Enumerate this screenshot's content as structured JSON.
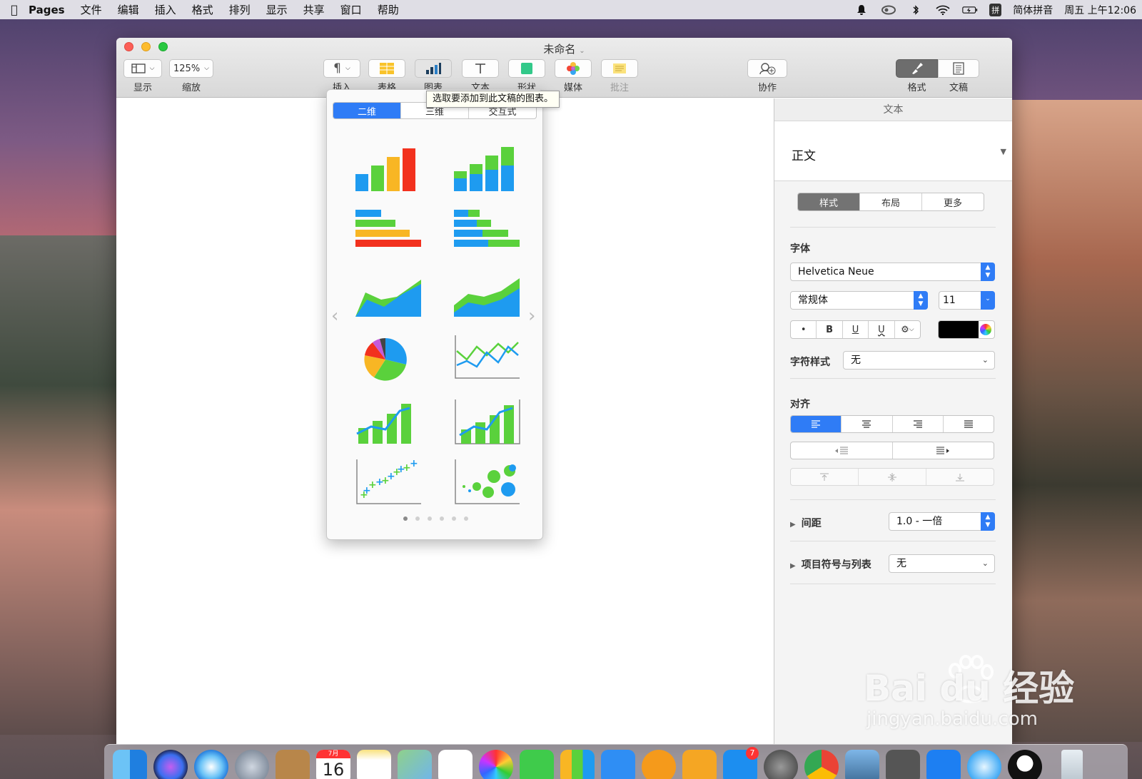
{
  "menubar": {
    "app_name": "Pages",
    "items": [
      "文件",
      "编辑",
      "插入",
      "格式",
      "排列",
      "显示",
      "共享",
      "窗口",
      "帮助"
    ],
    "input_method": "简体拼音",
    "input_badge": "拼",
    "clock": "周五 上午12:06"
  },
  "window": {
    "title": "未命名",
    "toolbar": {
      "view_label": "显示",
      "zoom_value": "125%",
      "zoom_label": "缩放",
      "insert_label": "插入",
      "table_label": "表格",
      "chart_label": "图表",
      "text_label": "文本",
      "shape_label": "形状",
      "media_label": "媒体",
      "comment_label": "批注",
      "collab_label": "协作",
      "format_label": "格式",
      "document_label": "文稿"
    }
  },
  "chart_popover": {
    "tabs": [
      "二维",
      "三维",
      "交互式"
    ],
    "active_tab": "二维",
    "tooltip": "选取要添加到此文稿的图表。",
    "page_count": 6,
    "current_page": 1,
    "chart_types": [
      "column",
      "stacked-column",
      "bar",
      "stacked-bar",
      "area",
      "stacked-area",
      "pie",
      "line",
      "mixed",
      "two-axis",
      "scatter",
      "bubble"
    ],
    "colors": {
      "blue": "#1e9bf0",
      "green": "#5ad13c",
      "orange": "#f8b624",
      "red": "#f2311e"
    }
  },
  "sidebar": {
    "tab_title": "文本",
    "paragraph_style": "正文",
    "subtabs": [
      "样式",
      "布局",
      "更多"
    ],
    "active_subtab": "样式",
    "font_heading": "字体",
    "font_family": "Helvetica Neue",
    "font_typeface": "常规体",
    "font_size": "11",
    "format_buttons": {
      "bold": "B",
      "italic": "•",
      "underline": "U",
      "strike": "U"
    },
    "char_style_label": "字符样式",
    "char_style_value": "无",
    "align_heading": "对齐",
    "spacing_label": "间距",
    "spacing_value": "1.0 - 一倍",
    "bullets_label": "项目符号与列表",
    "bullets_value": "无",
    "text_color": "#000000",
    "accent": "#2f7cf6"
  },
  "dock": {
    "calendar_month": "7月",
    "calendar_day": "16",
    "appstore_badge": "7"
  },
  "watermark": {
    "brand": "Bai du 经验",
    "url": "jingyan.baidu.com"
  }
}
